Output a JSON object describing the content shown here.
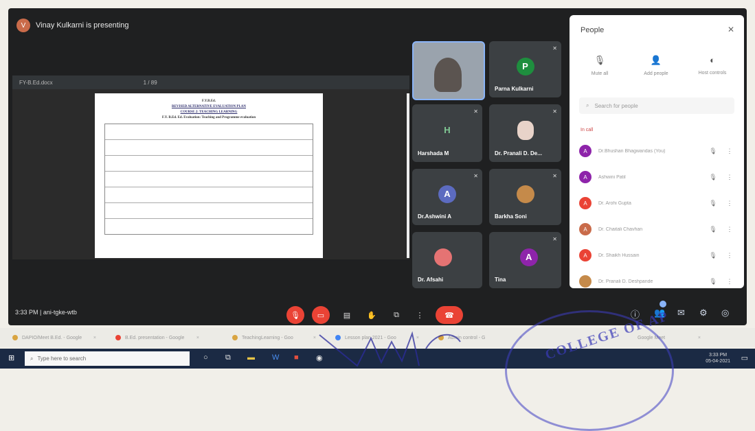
{
  "presenting": {
    "avatar_letter": "V",
    "text": "Vinay Kulkarni is presenting"
  },
  "document": {
    "toolbar_left": "FY-B.Ed.docx",
    "toolbar_mid": "1 / 89",
    "title1": "F.Y.B.Ed.",
    "title2": "REVISED ALTERNATIVE EVALUATION PLAN",
    "title3": "COURSE 2: TEACHING LEARNING",
    "title4": "F.Y. B.Ed. Ed. Evaluation: Teaching and Programme evaluation"
  },
  "tiles": [
    {
      "name": "",
      "type": "self"
    },
    {
      "name": "Parna Kulkarni",
      "letter": "P",
      "color": "#1e8e3e"
    },
    {
      "name": "Harshada M",
      "letter": "H",
      "color": "#3c4043"
    },
    {
      "name": "Dr. Pranali D. De...",
      "letter": "",
      "color": "#e8d3c9"
    },
    {
      "name": "Dr.Ashwini A",
      "letter": "A",
      "color": "#5c6bc0"
    },
    {
      "name": "Barkha Soni",
      "letter": "",
      "color": "#c58a4a"
    },
    {
      "name": "Dr. Afsahi",
      "letter": "",
      "color": "#e57373"
    },
    {
      "name": "Tina",
      "letter": "A",
      "color": "#8e24aa"
    }
  ],
  "people_panel": {
    "title": "People",
    "actions": [
      "Mute all",
      "Add people",
      "Host controls"
    ],
    "search_placeholder": "Search for people",
    "section": "In call",
    "rows": [
      {
        "letter": "A",
        "color": "#8e24aa",
        "name": "Dr.Bhushan Bhagwandas (You)"
      },
      {
        "letter": "A",
        "color": "#8e24aa",
        "name": "Ashwini Patil"
      },
      {
        "letter": "A",
        "color": "#ea4335",
        "name": "Dr. Arohi Gupta"
      },
      {
        "letter": "A",
        "color": "#c96b4a",
        "name": "Dr. Chaitali Chavhan"
      },
      {
        "letter": "A",
        "color": "#ea4335",
        "name": "Dr. Shaikh Hussain"
      },
      {
        "letter": "",
        "color": "#c58a4a",
        "name": "Dr. Pranali D. Deshpande"
      }
    ]
  },
  "bottom": {
    "time": "3:33 PM",
    "separator": "|",
    "meeting": "ani-tgke-wtb"
  },
  "browser_tabs": [
    "DAPIO/Meet B.Ed. - Google",
    "B.Ed. presentation - Google",
    "TeachingLearning - Goo",
    "Lesson plan 2021 - Goo",
    "Admin control - G",
    "Google Meet"
  ],
  "taskbar": {
    "search_placeholder": "Type here to search",
    "time": "3:33 PM",
    "date": "05-04-2021"
  },
  "stamp_text": "COLLEGE OF AP"
}
